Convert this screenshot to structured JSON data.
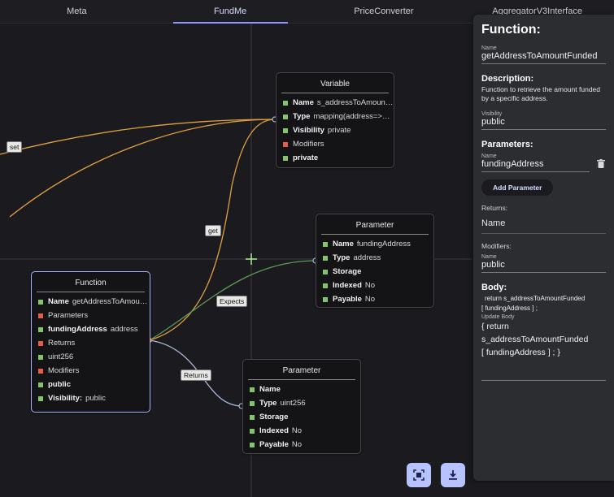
{
  "tabs": [
    "Meta",
    "FundMe",
    "PriceConverter",
    "AggregatorV3Interface"
  ],
  "active_tab": "FundMe",
  "edge_labels": {
    "set": "set",
    "get": "get",
    "expects": "Expects",
    "returns": "Returns"
  },
  "variable_node": {
    "title": "Variable",
    "rows": [
      {
        "color": "green",
        "key": "Name",
        "value": "s_addressToAmountF..."
      },
      {
        "color": "green",
        "key": "Type",
        "value": "mapping(address=>ui..."
      },
      {
        "color": "green",
        "key": "Visibility",
        "value": "private"
      },
      {
        "color": "red",
        "key": "",
        "value": "Modifiers"
      },
      {
        "color": "green",
        "key": "private",
        "value": ""
      }
    ]
  },
  "param_node_1": {
    "title": "Parameter",
    "rows": [
      {
        "color": "green",
        "key": "Name",
        "value": "fundingAddress"
      },
      {
        "color": "green",
        "key": "Type",
        "value": "address"
      },
      {
        "color": "green",
        "key": "Storage",
        "value": ""
      },
      {
        "color": "green",
        "key": "Indexed",
        "value": "No"
      },
      {
        "color": "green",
        "key": "Payable",
        "value": "No"
      }
    ]
  },
  "function_node": {
    "title": "Function",
    "rows": [
      {
        "color": "green",
        "key": "Name",
        "value": "getAddressToAmount..."
      },
      {
        "color": "red",
        "key": "",
        "value": "Parameters"
      },
      {
        "color": "green",
        "key": "fundingAddress",
        "value": "address"
      },
      {
        "color": "red",
        "key": "",
        "value": "Returns"
      },
      {
        "color": "green",
        "key": "",
        "value": " uint256"
      },
      {
        "color": "red",
        "key": "",
        "value": "Modifiers"
      },
      {
        "color": "green",
        "key": "public",
        "value": ""
      },
      {
        "color": "green",
        "key": "Visibility:",
        "value": "public"
      }
    ]
  },
  "param_node_2": {
    "title": "Parameter",
    "rows": [
      {
        "color": "green",
        "key": "Name",
        "value": ""
      },
      {
        "color": "green",
        "key": "Type",
        "value": "uint256"
      },
      {
        "color": "green",
        "key": "Storage",
        "value": ""
      },
      {
        "color": "green",
        "key": "Indexed",
        "value": "No"
      },
      {
        "color": "green",
        "key": "Payable",
        "value": "No"
      }
    ]
  },
  "buttons": {
    "fit_view_icon": "fit-view-icon",
    "download_icon": "download-icon"
  },
  "panel": {
    "heading": "Function:",
    "name_label": "Name",
    "name_value": "getAddressToAmountFunded",
    "description_heading": "Description:",
    "description_text": "Function to retrieve the amount funded by a specific address.",
    "visibility_label": "Visibility",
    "visibility_value": "public",
    "parameters_heading": "Parameters:",
    "param_name_label": "Name",
    "param_name_value": "fundingAddress",
    "add_parameter": "Add Parameter",
    "returns_label": "Returns:",
    "returns_name": "Name",
    "modifiers_label": "Modifiers:",
    "modifiers_name_label": "Name",
    "modifiers_name_value": "public",
    "body_heading": "Body:",
    "body_code_1": "return s_addressToAmountFunded",
    "body_code_2": "[ fundingAddress ] ;",
    "update_body_label": "Update Body",
    "update_body_1": "{ return",
    "update_body_2": "s_addressToAmountFunded",
    "update_body_3": "[ fundingAddress ] ; }"
  },
  "colors": {
    "accent": "#8f96ff",
    "set_get_edge": "#e0a040",
    "expects_edge": "#5f9a5a",
    "returns_edge": "#a9b9d6",
    "green_square": "#84c46b",
    "red_square": "#e65c4f",
    "panel_bg": "#2b2d31"
  }
}
